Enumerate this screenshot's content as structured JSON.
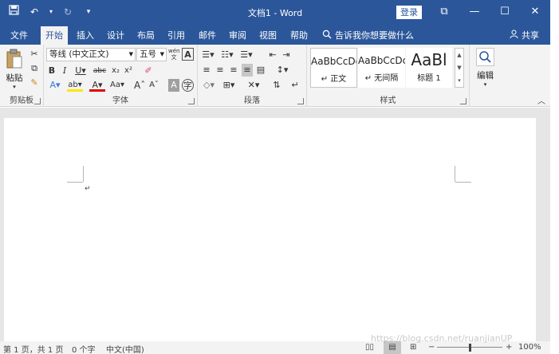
{
  "titlebar": {
    "title": "文档1 - Word",
    "login": "登录",
    "qat": {
      "save_icon": "save-icon",
      "undo_icon": "undo-icon",
      "redo_icon": "redo-icon",
      "customize_icon": "customize-qat-icon"
    },
    "window_buttons": {
      "ribbon_display": "⧉",
      "minimize": "—",
      "maximize": "☐",
      "close": "✕"
    }
  },
  "tabs": [
    {
      "label": "文件"
    },
    {
      "label": "开始"
    },
    {
      "label": "插入"
    },
    {
      "label": "设计"
    },
    {
      "label": "布局"
    },
    {
      "label": "引用"
    },
    {
      "label": "邮件"
    },
    {
      "label": "审阅"
    },
    {
      "label": "视图"
    },
    {
      "label": "帮助"
    }
  ],
  "tell_me": "告诉我你想要做什么",
  "share": "共享",
  "ribbon": {
    "clipboard": {
      "label": "剪贴板",
      "paste": "粘贴"
    },
    "font": {
      "label": "字体",
      "font_name": "等线 (中文正文)",
      "font_size": "五号",
      "wen": "wén",
      "big_a": "A"
    },
    "paragraph": {
      "label": "段落"
    },
    "styles": {
      "label": "样式",
      "items": [
        {
          "sample": "AaBbCcDc",
          "name": "↵ 正文"
        },
        {
          "sample": "AaBbCcDc",
          "name": "↵ 无间隔"
        },
        {
          "sample": "AaBl",
          "name": "标题 1"
        }
      ]
    },
    "editing": {
      "label": "编辑"
    }
  },
  "statusbar": {
    "page": "第 1 页，共 1 页",
    "words": "0 个字",
    "language": "中文(中国)",
    "zoom_minus": "−",
    "zoom_plus": "+",
    "zoom": "100%"
  },
  "watermark": "https://blog.csdn.net/ruanjianUP"
}
